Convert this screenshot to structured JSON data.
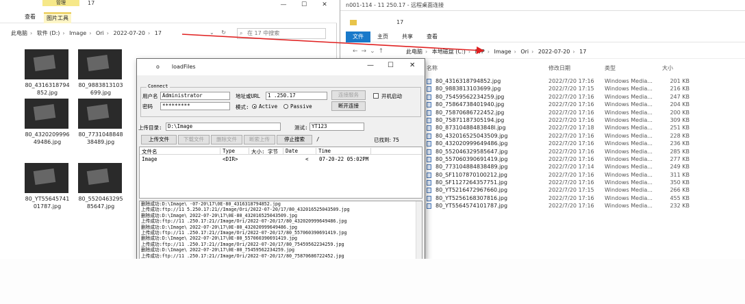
{
  "left_explorer": {
    "ribbon_context": "管理",
    "title": "17",
    "tabs": [
      "查看",
      "图片工具"
    ],
    "window_controls": [
      "—",
      "☐",
      "✕"
    ],
    "breadcrumb": [
      "此电脑",
      "软件 (D:)",
      "Image",
      "Ori",
      "2022-07-20",
      "17"
    ],
    "search_placeholder": "在 17 中搜索",
    "thumbnails": [
      {
        "caption": "80_4316318794852.jpg"
      },
      {
        "caption": "80_9883813103699.jpg"
      },
      {
        "caption": "80_4320209996 49486.jpg"
      },
      {
        "caption": "80_7731048848 38489.jpg"
      },
      {
        "caption": "80_YT55645741 01787.jpg"
      },
      {
        "caption": "80_5520463295 85647.jpg"
      }
    ]
  },
  "remote": {
    "title": "n001-114 - 11        250.17 - 远程桌面连接",
    "qat_label": "17",
    "tabs": [
      "文件",
      "主页",
      "共享",
      "查看"
    ],
    "breadcrumb": [
      "此电脑",
      "本地磁盘 (C:)",
      "FTP",
      "Image",
      "Ori",
      "2022-07-20",
      "17"
    ],
    "headers": {
      "name": "名称",
      "date": "修改日期",
      "type": "类型",
      "size": "大小"
    },
    "files": [
      {
        "name": "80_4316318794852.jpg",
        "date": "2022/7/20 17:16",
        "type": "Windows Media...",
        "size": "201 KB"
      },
      {
        "name": "80_9883813103699.jpg",
        "date": "2022/7/20 17:15",
        "type": "Windows Media...",
        "size": "216 KB"
      },
      {
        "name": "80_75459562234259.jpg",
        "date": "2022/7/20 17:16",
        "type": "Windows Media...",
        "size": "247 KB"
      },
      {
        "name": "80_75864738401940.jpg",
        "date": "2022/7/20 17:16",
        "type": "Windows Media...",
        "size": "204 KB"
      },
      {
        "name": "80_75870686722452.jpg",
        "date": "2022/7/20 17:16",
        "type": "Windows Media...",
        "size": "200 KB"
      },
      {
        "name": "80_75871187305194.jpg",
        "date": "2022/7/20 17:16",
        "type": "Windows Media...",
        "size": "309 KB"
      },
      {
        "name": "80_87310488483848l.jpg",
        "date": "2022/7/20 17:18",
        "type": "Windows Media...",
        "size": "251 KB"
      },
      {
        "name": "80_432016525043509.jpg",
        "date": "2022/7/20 17:16",
        "type": "Windows Media...",
        "size": "228 KB"
      },
      {
        "name": "80_432020999649486.jpg",
        "date": "2022/7/20 17:16",
        "type": "Windows Media...",
        "size": "236 KB"
      },
      {
        "name": "80_552046329585647.jpg",
        "date": "2022/7/20 17:16",
        "type": "Windows Media...",
        "size": "285 KB"
      },
      {
        "name": "80_557060390691419.jpg",
        "date": "2022/7/20 17:16",
        "type": "Windows Media...",
        "size": "277 KB"
      },
      {
        "name": "80_773104884838489.jpg",
        "date": "2022/7/20 17:14",
        "type": "Windows Media...",
        "size": "249 KB"
      },
      {
        "name": "80_SF1107870100212.jpg",
        "date": "2022/7/20 17:16",
        "type": "Windows Media...",
        "size": "311 KB"
      },
      {
        "name": "80_SF1127264357751.jpg",
        "date": "2022/7/20 17:16",
        "type": "Windows Media...",
        "size": "350 KB"
      },
      {
        "name": "80_YT5216472967660.jpg",
        "date": "2022/7/20 17:15",
        "type": "Windows Media...",
        "size": "266 KB"
      },
      {
        "name": "80_YT5256168307816.jpg",
        "date": "2022/7/20 17:16",
        "type": "Windows Media...",
        "size": "455 KB"
      },
      {
        "name": "80_YT5564574101787.jpg",
        "date": "2022/7/20 17:16",
        "type": "Windows Media...",
        "size": "232 KB"
      }
    ]
  },
  "dialog": {
    "title": "loadFiles",
    "title_prefix": "o",
    "controls": [
      "—",
      "☐",
      "✕"
    ],
    "group_title": "Connect",
    "username_label": "用户名",
    "username_value": "Administrator",
    "password_label": "密码",
    "password_value": "*********",
    "url_label": "地址或URL",
    "url_value": "1    .250.17",
    "mode_label": "模式:",
    "mode_active": "Active",
    "mode_passive": "Passive",
    "connect_btn": "连接服务",
    "disconnect_btn": "断开连接",
    "autostart_label": "开机启动",
    "upload_dir_label": "上传目录:",
    "upload_dir_value": "D:\\Image",
    "test_label": "测试:",
    "test_value": "YT123",
    "buttons": [
      "上传文件",
      "下载文件",
      "删除文件",
      "断索上传",
      "停止搜索"
    ],
    "slash": "/",
    "found_label": "已找到: 75",
    "list_headers": [
      "文件名",
      "Type",
      "大小: 字节",
      "Date",
      "Time"
    ],
    "list_row": {
      "name": "Image",
      "type": "<DIR>",
      "size": "",
      "date": "<",
      "time": "07-20-22  05:02PM"
    },
    "log_lines": [
      "删除成功:D:\\Image\\  -07-20\\17\\0E-80_4316318794852.jpg",
      "上传成功:ftp://11    5.250.17:21//Image/Ori/2022-07-20/17/80_432016525043509.jpg",
      "删除成功:D:\\Image\\  2022-07-20\\17\\0E-80_432016525043509.jpg",
      "上传成功:ftp://11    .250.17:21//Image/Ori/2022-07-20/17/80_432020999649486.jpg",
      "删除成功:D:\\Image\\  2022-07-20\\17\\0E-80_432020999649486.jpg",
      "上传成功:ftp://11    .250.17:21//Image/Ori/2022-07-20/17/80_557060390691419.jpg",
      "删除成功:D:\\Image\\  2022-07-20\\17\\0E-80_557060390691419.jpg",
      "上传成功:ftp://11    .250.17:21//Image/Ori/2022-07-20/17/80_75459562234259.jpg",
      "删除成功:D:\\Image\\  2022-07-20\\17\\0E-80_75459562234259.jpg",
      "上传成功:ftp://11    .250.17:21//Image/Ori/2022-07-20/17/80_75870686722452.jpg"
    ]
  },
  "colors": {
    "remote_tab_active": "#1979ca",
    "arrow": "#e02020"
  }
}
